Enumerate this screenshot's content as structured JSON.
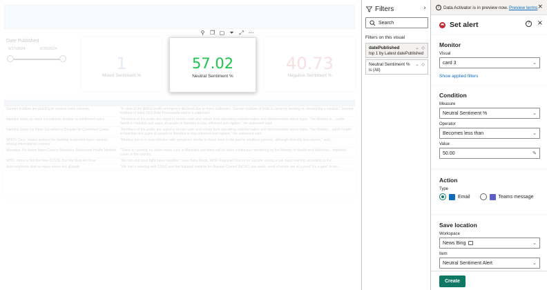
{
  "canvas": {
    "slicer": {
      "title": "Date Published",
      "start_date": "6/17/2024",
      "end_date": "6/30/2024"
    },
    "cards": [
      {
        "value": "1",
        "label": "Mixed Sentiment %",
        "color": "#a8c6ea"
      },
      {
        "value": "57.02",
        "label": "Neutral Sentiment %",
        "color": "#1ec44b"
      },
      {
        "value": "40.73",
        "label": "Negative Sentiment %",
        "color": "#e8a0a8"
      }
    ],
    "table_rows": [
      {
        "title": "Sarvam Institute are pointing to several mass volumes",
        "text": "\"In view of the global health emergency declared due to mpox outbreaks, Sarvam Institute of India is currently working on developing a vaccine,\" Sarvam Institute of India CEO Adar Poonawalla said in a statement."
      },
      {
        "title": "Namibia steps up mpox surveillance despite no confirmed cases",
        "text": "\"Members of the public are urged to remain calm and refrain from spreading misinformation and disinformation about mpox. The Ministry is... public health in Namibia and urges all people in Namibia to stay informed and vigilant,\" the statement said."
      },
      {
        "title": "Namibia Steps Up Mpox Surveillance Despite No Confirmed Cases",
        "text": "\"Members of the public are urged to remain calm and refrain from spreading misinformation and disinformation about mpox. The Ministry... public health in Namibia and urges all people in Namibia to stay informed and vigilant,\" the statement said."
      },
      {
        "title": "WHO's Dam: 'issues protocol for tackling suspected mpox variants among international concern'",
        "text": "\"Monkey pox is a virus infection with symptoms similar to those seen in the past in smallpox patients, although clinically less severe,\" said..."
      },
      {
        "title": "Mauritius: No Active Mpox Case in Mauritius, Reassures Health Minister",
        "text": "\"There is currently no active mpox case in Mauritius and there will be close continuous monitoring by the Ministry of Health and Wellness... imported cases in the country."
      },
      {
        "title": "WHO: mpox is Not the New COVID, But We Must Act Now",
        "text": "\"We can and must fight mpox together,\" says Hans Kluge, WHO Regional Director for Europe, during a call mpox briefing, according to the..."
      },
      {
        "title": "Asia heightens alert as mpox raises risk globally",
        "text": "\"We had a meeting with CDSO and the National Institute for Disease Control (NCDC) last week, most of whom are at a point\" it's a gate\" in the..."
      }
    ]
  },
  "filters": {
    "title": "Filters",
    "search_placeholder": "Search",
    "on_visual_label": "Filters on this visual",
    "items": [
      {
        "name": "datePublished",
        "summary": "top 1 by Latest datePublished"
      },
      {
        "name": "Neutral Sentiment %",
        "summary": "is (All)"
      }
    ]
  },
  "alert": {
    "info": "Data Activator is in preview now.",
    "info_link": "Preview terms",
    "title": "Set alert",
    "monitor": {
      "title": "Monitor",
      "visual_label": "Visual",
      "visual_value": "card 3",
      "show_filters": "Show applied filters"
    },
    "condition": {
      "title": "Condition",
      "measure_label": "Measure",
      "measure_value": "Neutral Sentiment %",
      "operator_label": "Operator",
      "operator_value": "Becomes less than",
      "value_label": "Value",
      "value_value": "50.00"
    },
    "action": {
      "title": "Action",
      "type_label": "Type",
      "email_label": "Email",
      "teams_label": "Teams message"
    },
    "save": {
      "title": "Save location",
      "workspace_label": "Workspace",
      "workspace_value": "News Bing",
      "item_label": "Item",
      "item_value": "Neutral Sentiment Alert"
    },
    "create_label": "Create"
  }
}
